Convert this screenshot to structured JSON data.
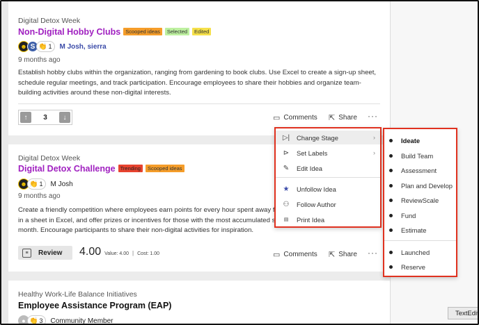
{
  "cards": [
    {
      "category": "Digital Detox Week",
      "title": "Non-Digital Hobby Clubs",
      "badges": [
        "Scooped ideas",
        "Selected",
        "Edited"
      ],
      "avatar_initial": "S",
      "reaction_count": "1",
      "authors": "M Josh, sierra",
      "time": "9 months ago",
      "description": "Establish hobby clubs within the organization, ranging from gardening to book clubs. Use Excel to create a sign-up sheet, schedule regular meetings, and track participation. Encourage employees to share their hobbies and organize team-building activities around these non-digital interests.",
      "vote_count": "3",
      "comments_label": "Comments",
      "share_label": "Share"
    },
    {
      "category": "Digital Detox Week",
      "title": "Digital Detox Challenge",
      "badges": [
        "Trending",
        "Scooped ideas"
      ],
      "reaction_count": "1",
      "authors": "M Josh",
      "time": "9 months ago",
      "description": "Create a friendly competition where employees earn points for every hour spent away from digital devices. Track progress in a sheet in Excel, and offer prizes or incentives for those with the most accumulated screen-free hours by the end of the month. Encourage participants to share their non-digital activities for inspiration.",
      "review_label": "Review",
      "score": "4.00",
      "value_text": "Value: 4.00",
      "cost_text": "Cost: 1.00",
      "comments_label": "Comments",
      "share_label": "Share"
    },
    {
      "category": "Healthy Work-Life Balance Initiatives",
      "title": "Employee Assistance Program (EAP)",
      "reaction_count": "3",
      "authors": "Community Member"
    }
  ],
  "menu": {
    "items": [
      {
        "label": "Change Stage",
        "icon": "play-bar-icon",
        "submenu": true
      },
      {
        "label": "Set Labels",
        "icon": "label-icon",
        "submenu": true
      },
      {
        "label": "Edit Idea",
        "icon": "pencil-icon"
      },
      {
        "label": "Unfollow Idea",
        "icon": "star-icon"
      },
      {
        "label": "Follow Author",
        "icon": "user-follow-icon"
      },
      {
        "label": "Print Idea",
        "icon": "pdf-icon"
      }
    ]
  },
  "stages": {
    "items": [
      "Ideate",
      "Build Team",
      "Assessment",
      "Plan and Develop",
      "ReviewScale",
      "Fund",
      "Estimate",
      "Launched",
      "Reserve"
    ],
    "current": "Ideate"
  },
  "tooltip": "TextEdit",
  "colors": {
    "accent_title": "#a020c0",
    "author_link": "#3a4aa8",
    "highlight_border": "#e0311f"
  }
}
